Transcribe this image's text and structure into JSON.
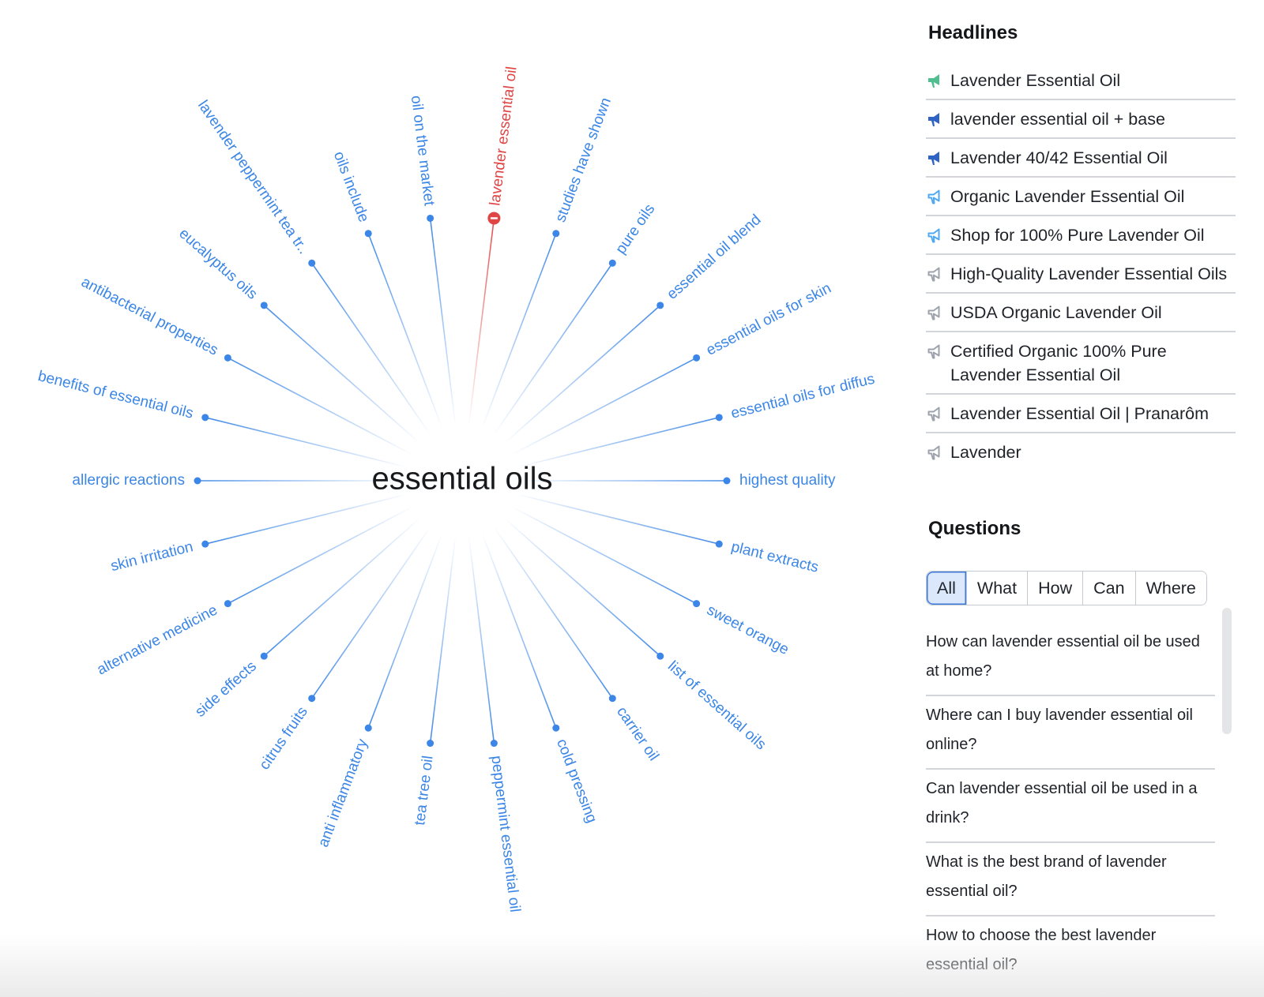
{
  "mindmap": {
    "center_label": "essential oils",
    "node_color": "#3b86e6",
    "active_color": "#e04545",
    "nodes": [
      {
        "label": "allergic reactions",
        "active": false
      },
      {
        "label": "benefits of essential oils",
        "active": false
      },
      {
        "label": "antibacterial properties",
        "active": false
      },
      {
        "label": "eucalyptus oils",
        "active": false
      },
      {
        "label": "lavender peppermint tea tr..",
        "active": false
      },
      {
        "label": "oils include",
        "active": false
      },
      {
        "label": "oil on the market",
        "active": false
      },
      {
        "label": "lavender essential oil",
        "active": true
      },
      {
        "label": "studies have shown",
        "active": false
      },
      {
        "label": "pure oils",
        "active": false
      },
      {
        "label": "essential oil blend",
        "active": false
      },
      {
        "label": "essential oils for skin",
        "active": false
      },
      {
        "label": "essential oils for diffus",
        "active": false
      },
      {
        "label": "highest quality",
        "active": false
      },
      {
        "label": "plant extracts",
        "active": false
      },
      {
        "label": "sweet orange",
        "active": false
      },
      {
        "label": "list of essential oils",
        "active": false
      },
      {
        "label": "carrier oil",
        "active": false
      },
      {
        "label": "cold pressing",
        "active": false
      },
      {
        "label": "peppermint essential oil",
        "active": false
      },
      {
        "label": "tea tree oil",
        "active": false
      },
      {
        "label": "anti inflammatory",
        "active": false
      },
      {
        "label": "citrus fruits",
        "active": false
      },
      {
        "label": "side effects",
        "active": false
      },
      {
        "label": "alternative medicine",
        "active": false
      },
      {
        "label": "skin irritation",
        "active": false
      }
    ]
  },
  "headlines": {
    "title": "Headlines",
    "items": [
      {
        "text": "Lavender Essential Oil",
        "icon": "megaphone-icon",
        "icon_color": "#4fbf8f"
      },
      {
        "text": "lavender essential oil + base",
        "icon": "megaphone-icon",
        "icon_color": "#2f63c4"
      },
      {
        "text": "Lavender 40/42 Essential Oil",
        "icon": "megaphone-icon",
        "icon_color": "#2f63c4"
      },
      {
        "text": "Organic Lavender Essential Oil",
        "icon": "megaphone-outline-icon",
        "icon_color": "#4fa8f3"
      },
      {
        "text": "Shop for 100% Pure Lavender Oil",
        "icon": "megaphone-outline-icon",
        "icon_color": "#4fa8f3"
      },
      {
        "text": "High-Quality Lavender Essential Oils",
        "icon": "megaphone-outline-icon",
        "icon_color": "#9ea3ab"
      },
      {
        "text": "USDA Organic Lavender Oil",
        "icon": "megaphone-outline-icon",
        "icon_color": "#9ea3ab"
      },
      {
        "text": "Certified Organic 100% Pure Lavender Essential Oil",
        "icon": "megaphone-outline-icon",
        "icon_color": "#9ea3ab"
      },
      {
        "text": "Lavender Essential Oil | Pranarôm",
        "icon": "megaphone-outline-icon",
        "icon_color": "#9ea3ab"
      },
      {
        "text": "Lavender",
        "icon": "megaphone-outline-icon",
        "icon_color": "#9ea3ab"
      }
    ]
  },
  "questions": {
    "title": "Questions",
    "tabs": [
      {
        "label": "All",
        "active": true
      },
      {
        "label": "What",
        "active": false
      },
      {
        "label": "How",
        "active": false
      },
      {
        "label": "Can",
        "active": false
      },
      {
        "label": "Where",
        "active": false
      }
    ],
    "items": [
      "How can lavender essential oil be used at home?",
      "Where can I buy lavender essential oil online?",
      "Can lavender essential oil be used in a drink?",
      "What is the best brand of lavender essential oil?",
      "How to choose the best lavender essential oil?"
    ]
  }
}
